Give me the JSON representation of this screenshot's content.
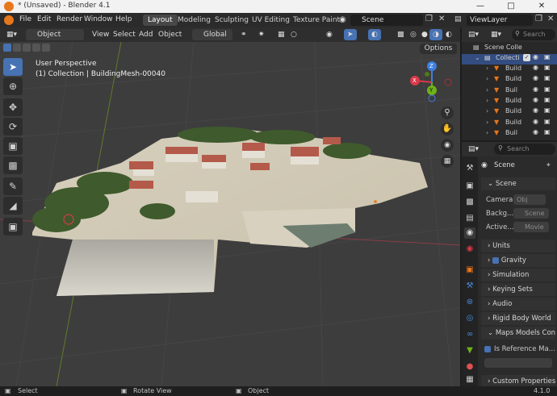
{
  "window": {
    "title": "* (Unsaved) - Blender 4.1"
  },
  "menu": [
    "File",
    "Edit",
    "Render",
    "Window",
    "Help"
  ],
  "workspaces": [
    "Layout",
    "Modeling",
    "Sculpting",
    "UV Editing",
    "Texture Paint"
  ],
  "scene_selector": "Scene",
  "view_layer": "ViewLayer",
  "viewport_header": {
    "mode": "Object Mode",
    "menus": [
      "View",
      "Select",
      "Add",
      "Object"
    ],
    "transform_orientation": "Global",
    "options": "Options"
  },
  "viewport": {
    "perspective": "User Perspective",
    "info": "(1) Collection | BuildingMesh-00040",
    "gizmo": {
      "z": "Z",
      "y": "Y",
      "x": "X"
    }
  },
  "outliner": {
    "search": "Search",
    "scene_collection": "Scene Colle",
    "collection": "Collecti",
    "items": [
      "Build",
      "Build",
      "Buil",
      "Build",
      "Build",
      "Build",
      "Buil"
    ]
  },
  "properties": {
    "search": "Search",
    "context": "Scene",
    "panels": {
      "scene": "Scene",
      "camera_label": "Camera",
      "camera_value": "Obj",
      "background_label": "Backg...",
      "background_value": "Scene",
      "active_label": "Active...",
      "active_value": "Movie",
      "units": "Units",
      "gravity": "Gravity",
      "simulation": "Simulation",
      "keying_sets": "Keying Sets",
      "audio": "Audio",
      "rigid_body_world": "Rigid Body World",
      "maps_models": "Maps Models Contex",
      "is_reference": "Is Reference Ma...",
      "custom_properties": "Custom Properties"
    }
  },
  "statusbar": {
    "select": "Select",
    "rotate": "Rotate View",
    "object": "Object",
    "version": "4.1.0"
  },
  "colors": {
    "accent": "#4772b3",
    "x_axis": "#d8394a",
    "y_axis": "#6fb21a",
    "z_axis": "#3d7ee0"
  }
}
